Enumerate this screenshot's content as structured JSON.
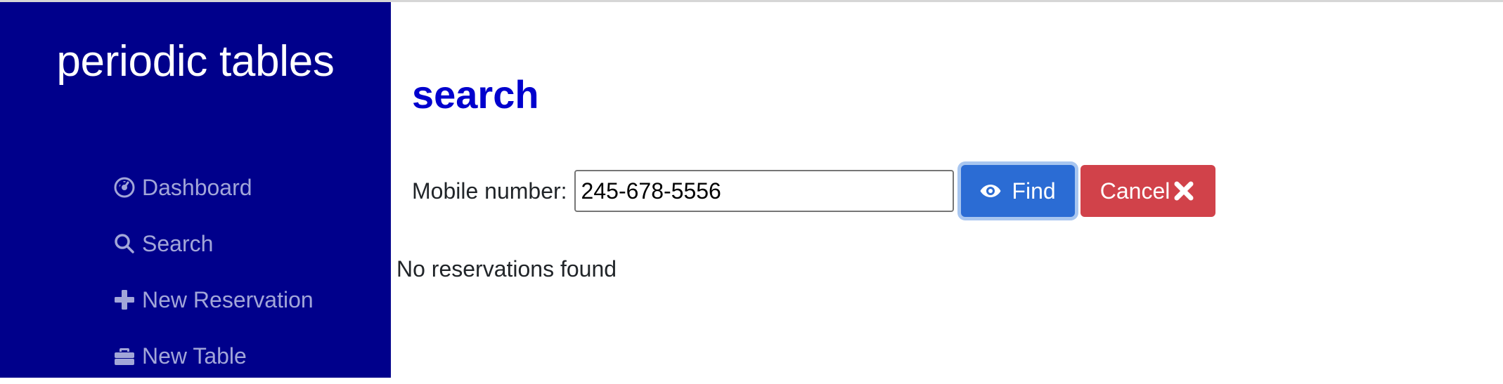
{
  "sidebar": {
    "brand": "periodic tables",
    "items": [
      {
        "label": "Dashboard",
        "icon": "dashboard-icon"
      },
      {
        "label": "Search",
        "icon": "search-icon"
      },
      {
        "label": "New Reservation",
        "icon": "plus-icon"
      },
      {
        "label": "New Table",
        "icon": "briefcase-icon"
      }
    ]
  },
  "main": {
    "title": "search",
    "search": {
      "label": "Mobile number:",
      "value": "245-678-5556",
      "find_label": "Find",
      "cancel_label": "Cancel"
    },
    "result": "No reservations found"
  },
  "colors": {
    "sidebar_bg": "#00008b",
    "title": "#0000cd",
    "find_button": "#2b6cd4",
    "cancel_button": "#d1424a",
    "nav_text": "#a2a6d8"
  }
}
